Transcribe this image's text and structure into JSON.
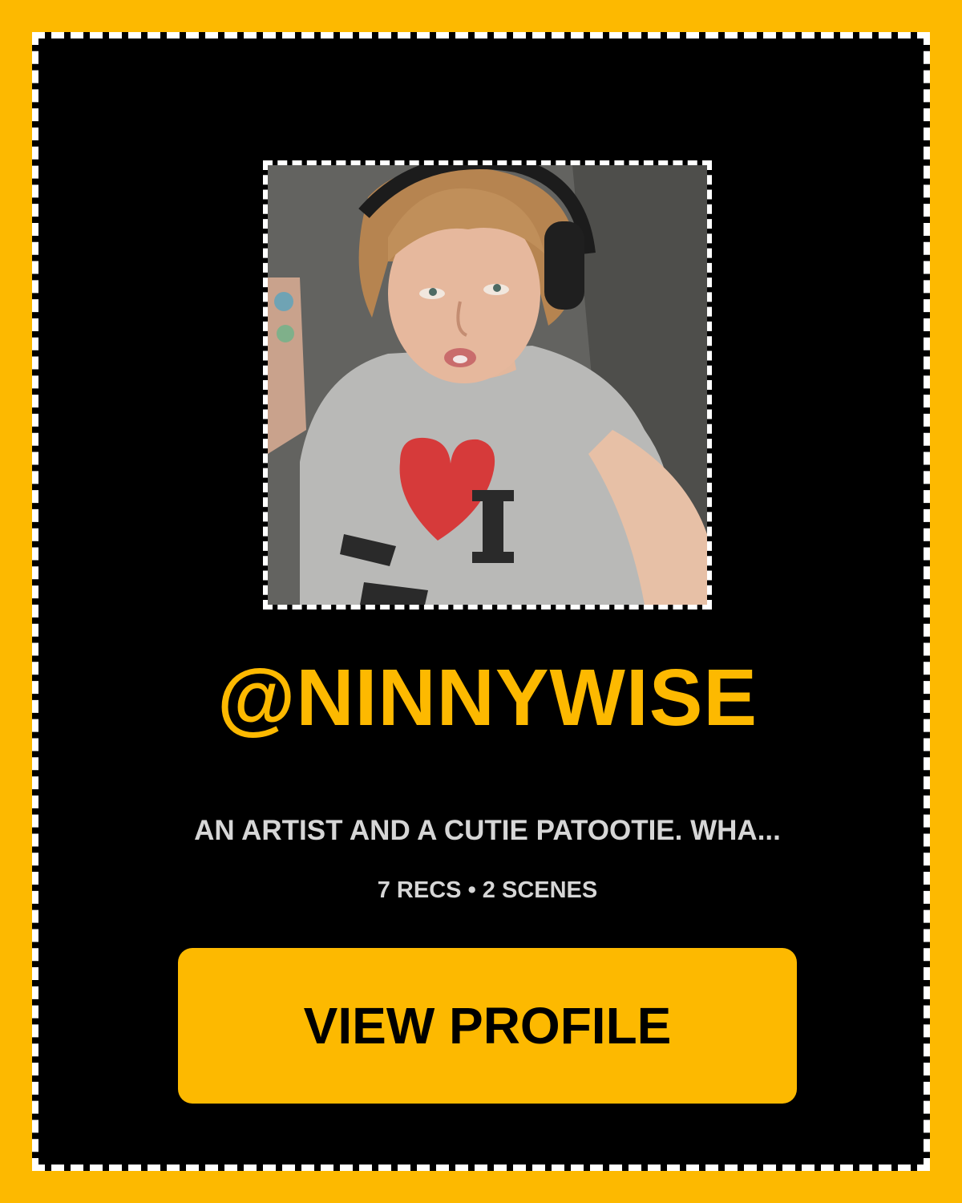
{
  "profile": {
    "avatar_alt": "Profile photo",
    "username": "@NINNYWISE",
    "bio": "AN ARTIST AND A CUTIE PATOOTIE. WHA...",
    "stats": {
      "recs": "7 RECS",
      "separator": "•",
      "scenes": "2 SCENES"
    },
    "cta_label": "VIEW PROFILE"
  },
  "colors": {
    "background": "#FDB900",
    "card": "#000000",
    "accent": "#FDB900",
    "text_muted": "#d6d6d6",
    "dash_border": "#ffffff"
  }
}
